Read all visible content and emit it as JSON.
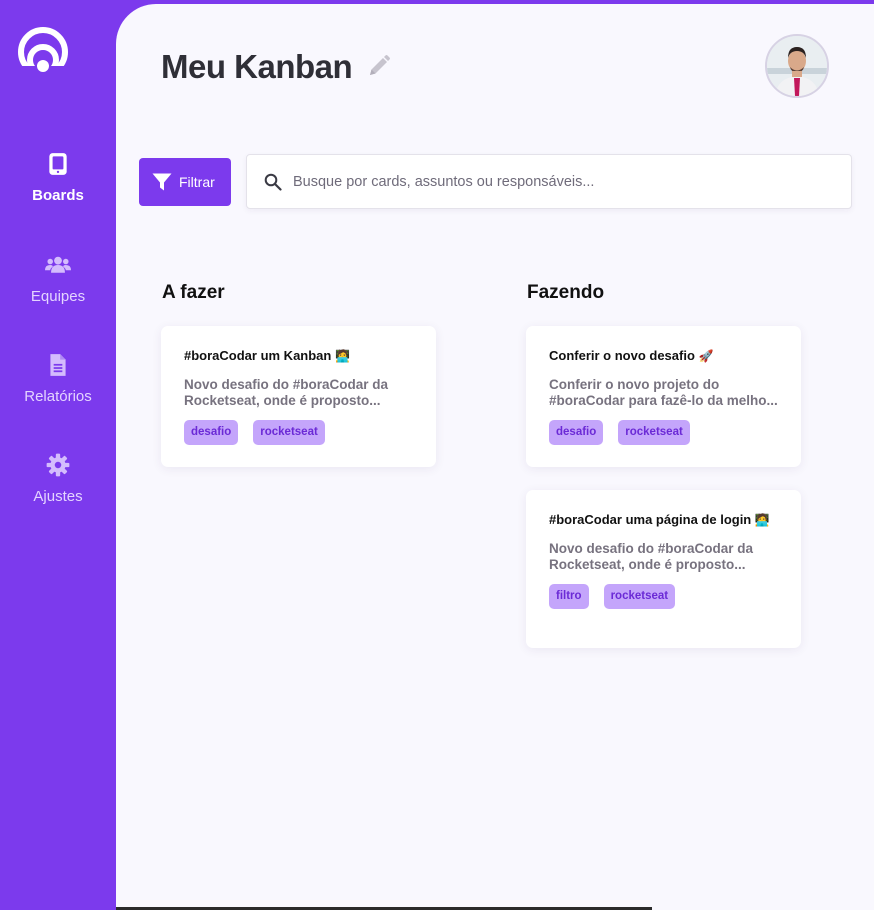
{
  "sidebar": {
    "items": [
      {
        "label": "Boards",
        "icon": "tablet-icon",
        "active": true
      },
      {
        "label": "Equipes",
        "icon": "users-icon",
        "active": false
      },
      {
        "label": "Relatórios",
        "icon": "file-icon",
        "active": false
      },
      {
        "label": "Ajustes",
        "icon": "gear-icon",
        "active": false
      }
    ]
  },
  "header": {
    "title": "Meu Kanban"
  },
  "toolbar": {
    "filter_label": "Filtrar",
    "search_placeholder": "Busque por cards, assuntos ou responsáveis..."
  },
  "columns": [
    {
      "title": "A fazer",
      "cards": [
        {
          "title": "#boraCodar um Kanban",
          "title_emoji": "🧑‍💻",
          "description": "Novo desafio do #boraCodar da Rocketseat, onde é proposto...",
          "tags": [
            "desafio",
            "rocketseat"
          ]
        }
      ]
    },
    {
      "title": "Fazendo",
      "cards": [
        {
          "title": "Conferir o novo desafio",
          "title_emoji": "🚀",
          "description": "Conferir o novo projeto do #boraCodar para fazê-lo da melho...",
          "tags": [
            "desafio",
            "rocketseat"
          ]
        },
        {
          "title": "#boraCodar uma página de login",
          "title_emoji": "🧑‍💻",
          "description": "Novo desafio do #boraCodar da Rocketseat, onde é proposto...",
          "tags": [
            "filtro",
            "rocketseat"
          ]
        }
      ]
    }
  ],
  "colors": {
    "brand": "#7c3aed",
    "background": "#f9f8fe",
    "tag_bg": "#c4a5fb",
    "tag_text": "#6b2ad6"
  }
}
